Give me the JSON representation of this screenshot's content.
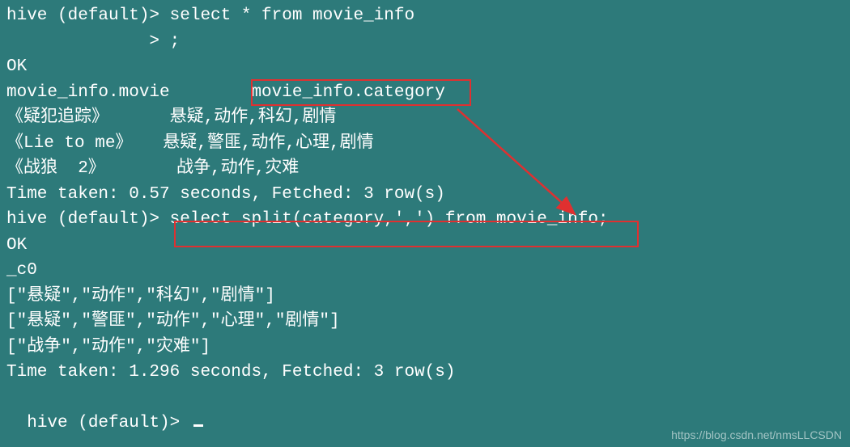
{
  "lines": {
    "l1": "hive (default)> select * from movie_info",
    "l2": "              > ;",
    "l3": "OK",
    "l4": "movie_info.movie        movie_info.category",
    "l5": "《疑犯追踪》      悬疑,动作,科幻,剧情",
    "l6": "《Lie to me》   悬疑,警匪,动作,心理,剧情",
    "l7": "《战狼  2》       战争,动作,灾难",
    "l8": "Time taken: 0.57 seconds, Fetched: 3 row(s)",
    "l9": "hive (default)> select split(category,',') from movie_info;",
    "l10": "OK",
    "l11": "_c0",
    "l12": "[\"悬疑\",\"动作\",\"科幻\",\"剧情\"]",
    "l13": "[\"悬疑\",\"警匪\",\"动作\",\"心理\",\"剧情\"]",
    "l14": "[\"战争\",\"动作\",\"灾难\"]",
    "l15": "Time taken: 1.296 seconds, Fetched: 3 row(s)",
    "l16": "hive (default)> "
  },
  "watermark": "https://blog.csdn.net/nmsLLCSDN",
  "colors": {
    "background": "#2d7a7a",
    "text": "#ffffff",
    "highlight_border": "#e03030"
  }
}
